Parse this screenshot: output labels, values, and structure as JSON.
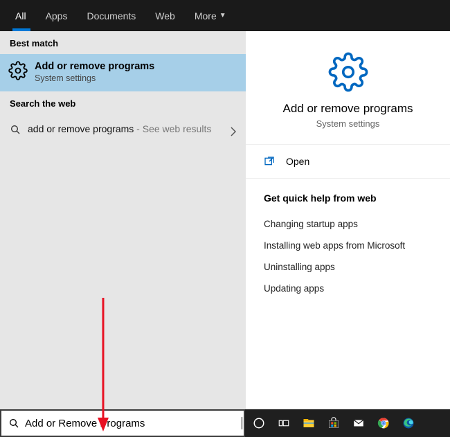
{
  "tabs": {
    "all": "All",
    "apps": "Apps",
    "documents": "Documents",
    "web": "Web",
    "more": "More"
  },
  "left": {
    "best_match_header": "Best match",
    "best_match": {
      "title": "Add or remove programs",
      "subtitle": "System settings"
    },
    "web_header": "Search the web",
    "web": {
      "prefix": "add or remove programs",
      "suffix": " - See web results"
    }
  },
  "right": {
    "title": "Add or remove programs",
    "subtitle": "System settings",
    "open_label": "Open",
    "quick_help_header": "Get quick help from web",
    "links": [
      "Changing startup apps",
      "Installing web apps from Microsoft",
      "Uninstalling apps",
      "Updating apps"
    ]
  },
  "search": {
    "value": "Add or Remove Programs"
  }
}
